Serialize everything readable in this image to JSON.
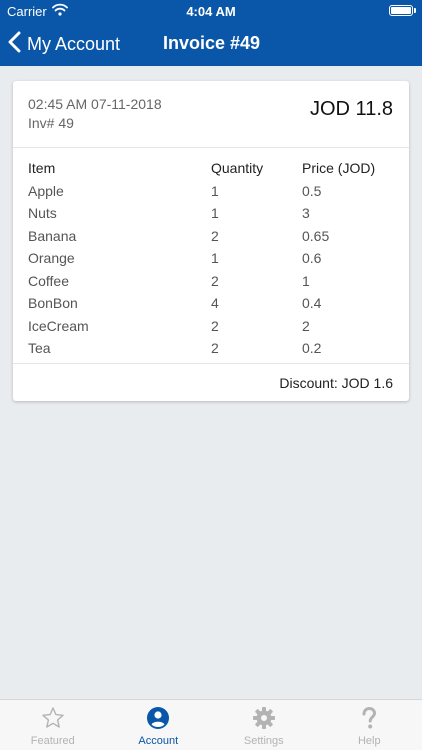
{
  "status_bar": {
    "carrier": "Carrier",
    "time": "4:04 AM"
  },
  "nav": {
    "back_label": "My Account",
    "title": "Invoice #49"
  },
  "invoice": {
    "datetime": "02:45 AM 07-11-2018",
    "number": "Inv# 49",
    "total": "JOD 11.8",
    "columns": [
      "Item",
      "Quantity",
      "Price (JOD)"
    ],
    "items": [
      {
        "name": "Apple",
        "qty": "1",
        "price": "0.5"
      },
      {
        "name": "Nuts",
        "qty": "1",
        "price": "3"
      },
      {
        "name": "Banana",
        "qty": "2",
        "price": "0.65"
      },
      {
        "name": "Orange",
        "qty": "1",
        "price": "0.6"
      },
      {
        "name": "Coffee",
        "qty": "2",
        "price": "1"
      },
      {
        "name": "BonBon",
        "qty": "4",
        "price": "0.4"
      },
      {
        "name": "IceCream",
        "qty": "2",
        "price": "2"
      },
      {
        "name": "Tea",
        "qty": "2",
        "price": "0.2"
      }
    ],
    "discount": "Discount: JOD 1.6"
  },
  "tabs": [
    {
      "label": "Featured",
      "icon": "star-icon",
      "active": false
    },
    {
      "label": "Account",
      "icon": "account-icon",
      "active": true
    },
    {
      "label": "Settings",
      "icon": "gear-icon",
      "active": false
    },
    {
      "label": "Help",
      "icon": "question-icon",
      "active": false
    }
  ],
  "colors": {
    "primary": "#0a56a8",
    "background": "#e9ecef",
    "tab_inactive": "#b3b3b3"
  }
}
